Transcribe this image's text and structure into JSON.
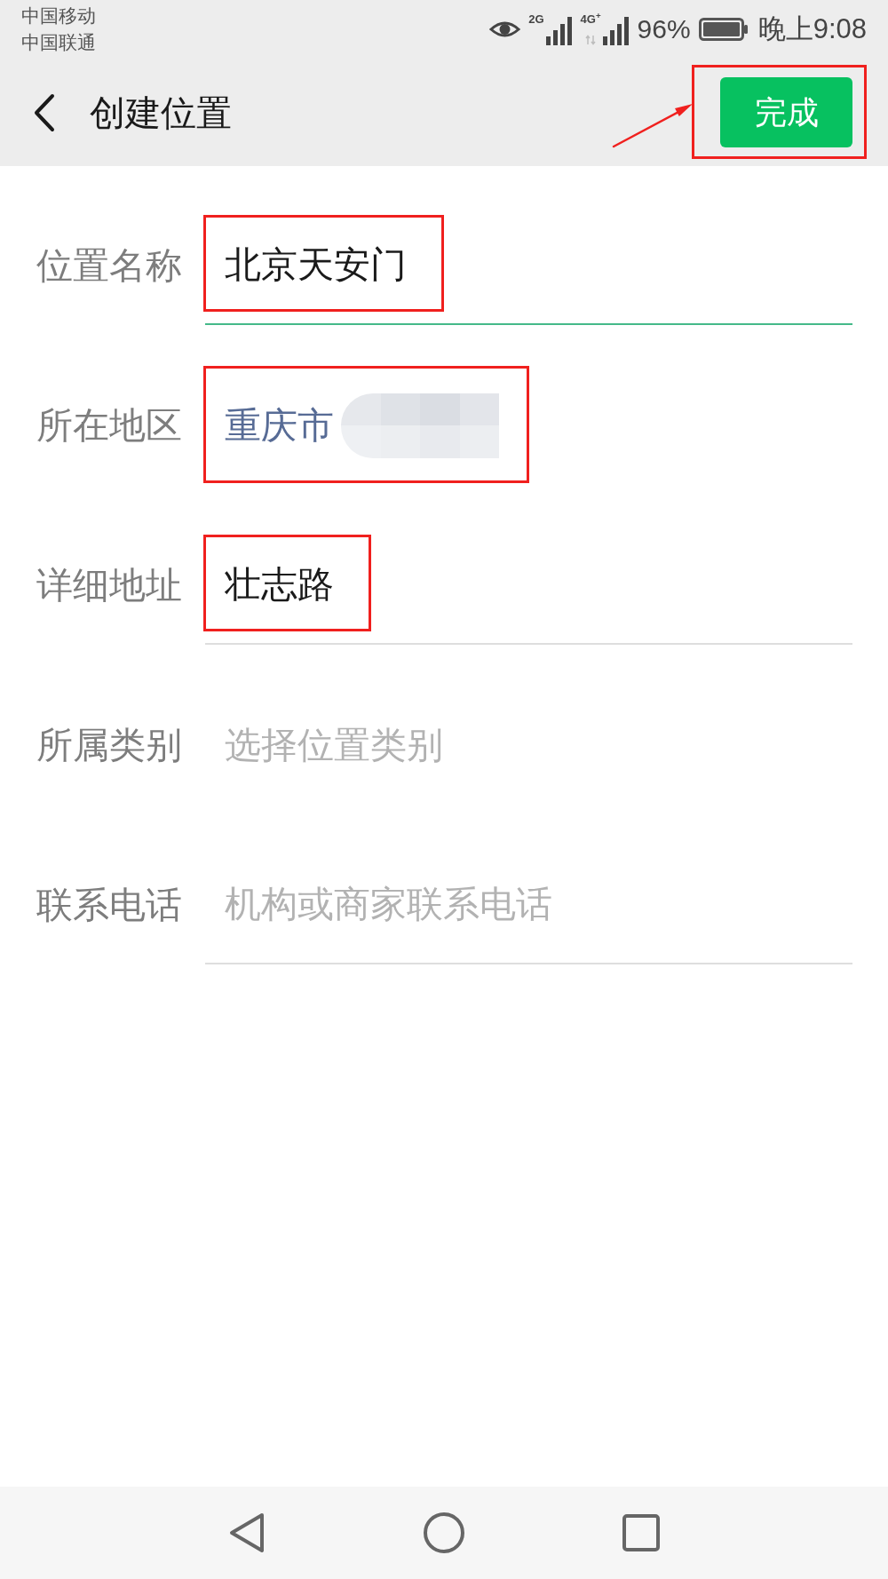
{
  "status_bar": {
    "carriers": [
      "中国移动",
      "中国联通"
    ],
    "signals": [
      {
        "label": "2G"
      },
      {
        "label": "4G$^{+}$",
        "data_arrows": true
      }
    ],
    "battery": "96%",
    "time": "晚上9:08"
  },
  "header": {
    "title": "创建位置",
    "done_button": {
      "label": "完成",
      "highlighted": true,
      "pointed_at": true
    }
  },
  "form": {
    "fields": [
      {
        "kind": "input",
        "label": "位置名称",
        "value": "北京天安门",
        "focused": true,
        "highlighted": true
      },
      {
        "kind": "picker",
        "label": "所在地区",
        "value": "重庆市",
        "redacted": true,
        "highlighted": true
      },
      {
        "kind": "input",
        "label": "详细地址",
        "value": "壮志路",
        "focused": false,
        "highlighted": true
      },
      {
        "kind": "picker",
        "label": "所属类别",
        "placeholder": "选择位置类别"
      },
      {
        "kind": "input",
        "label": "联系电话",
        "placeholder": "机构或商家联系电话",
        "focused": false
      }
    ]
  }
}
